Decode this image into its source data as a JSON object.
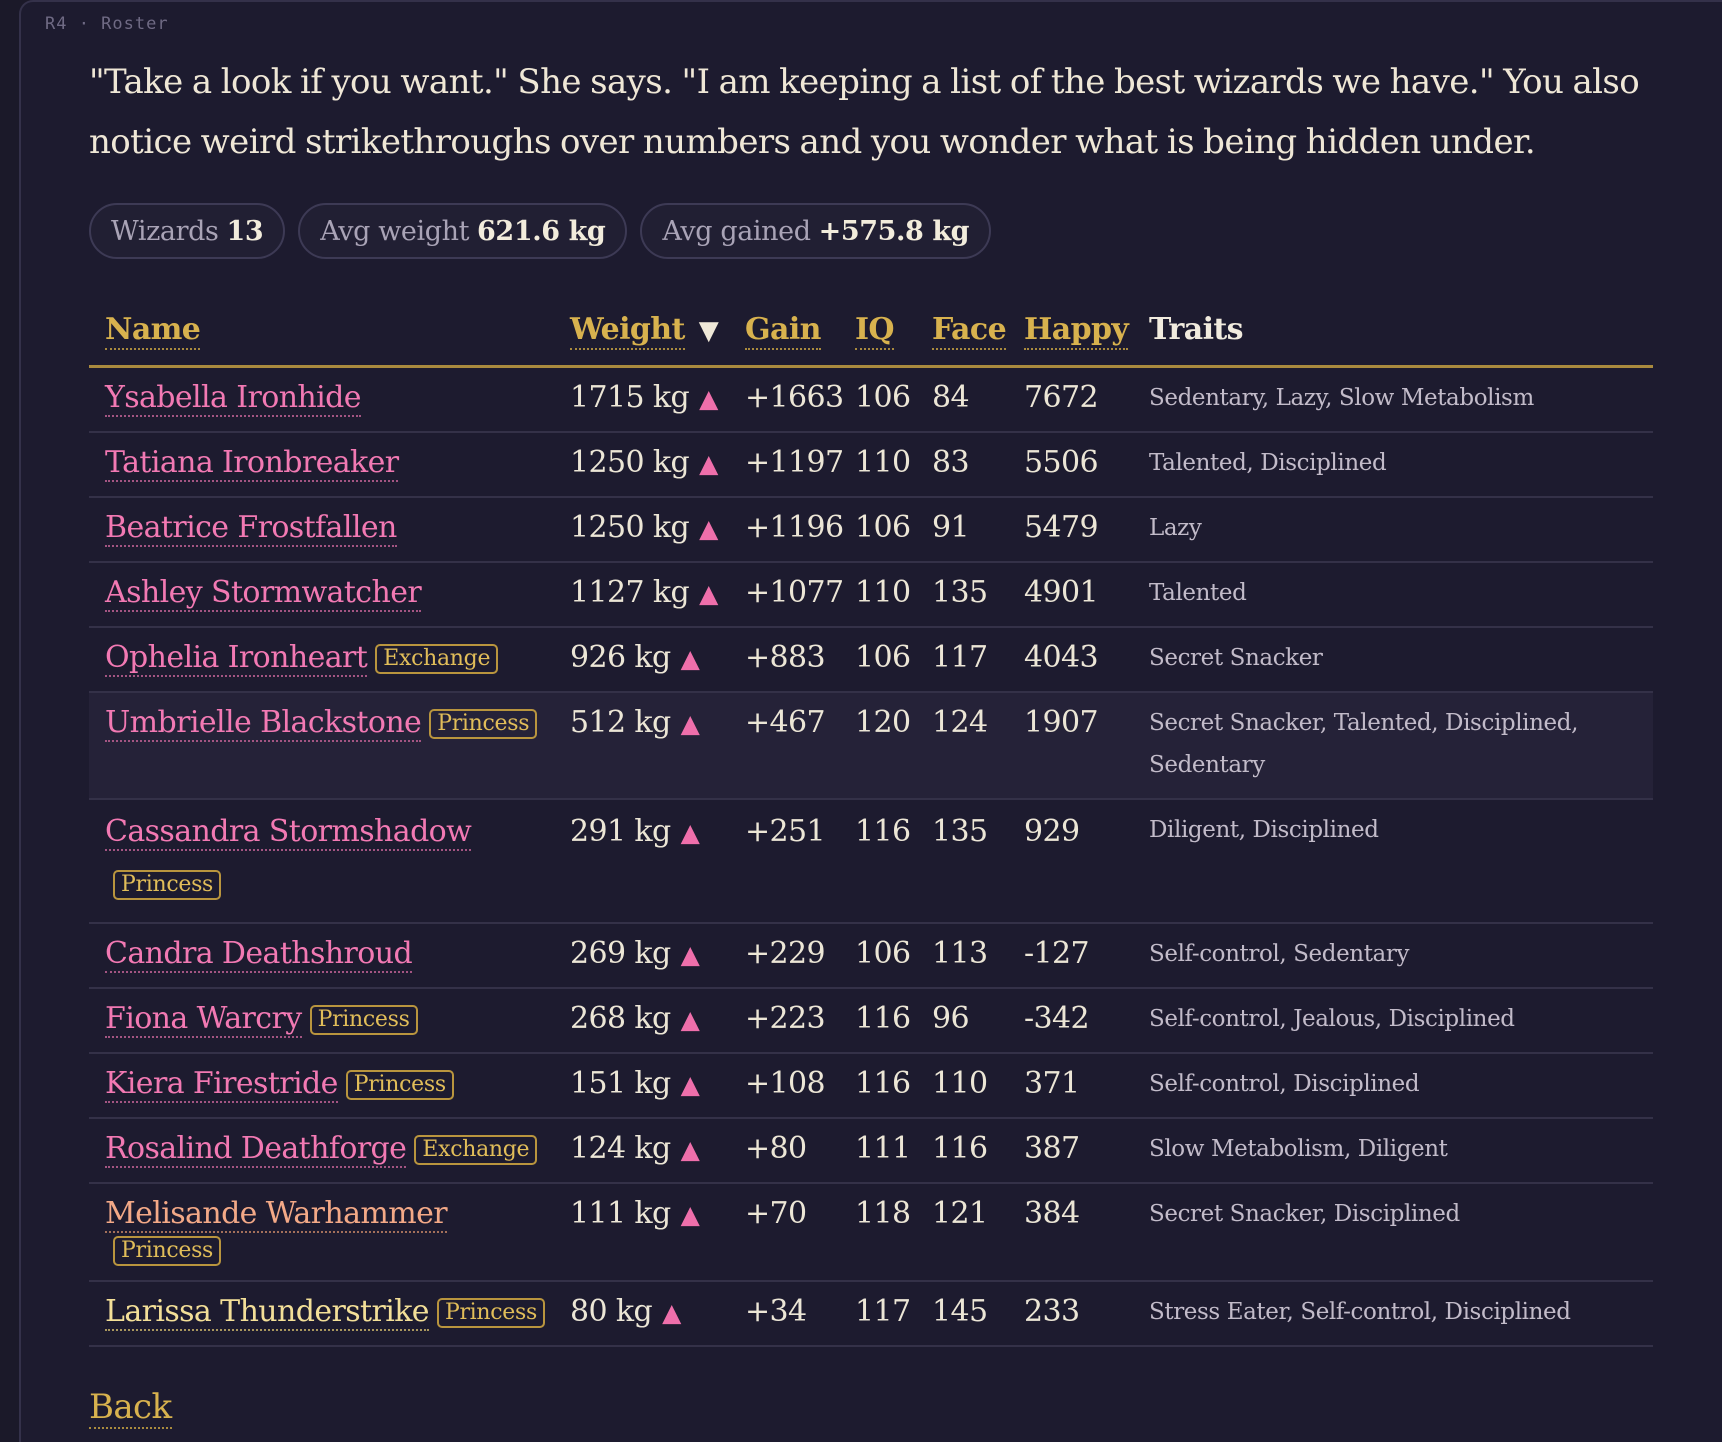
{
  "header": {
    "tag": "R4 · Roster"
  },
  "intro": "\"Take a look if you want.\" She says. \"I am keeping a list of the best wizards we have.\" You also notice weird strikethroughs over numbers and you wonder what is being hidden under.",
  "stats": [
    {
      "label": "Wizards",
      "value": "13"
    },
    {
      "label": "Avg weight",
      "value": "621.6 kg"
    },
    {
      "label": "Avg gained",
      "value": "+575.8 kg"
    }
  ],
  "columns": {
    "name": "Name",
    "weight": "Weight",
    "gain": "Gain",
    "iq": "IQ",
    "face": "Face",
    "happy": "Happy",
    "traits": "Traits"
  },
  "icons": {
    "sort": "triangle-down-icon",
    "trend": "triangle-up-icon"
  },
  "colors": {
    "accent": "#d8b24e",
    "name": "#f279b3",
    "name_orange": "#f3a987",
    "name_yellow": "#f3df98"
  },
  "rows": [
    {
      "name": "Ysabella Ironhide",
      "badge": "",
      "weight": "1715 kg",
      "gain": "+1663",
      "iq": "106",
      "face": "84",
      "happy": "7672",
      "traits": "Sedentary, Lazy, Slow Metabolism"
    },
    {
      "name": "Tatiana Ironbreaker",
      "badge": "",
      "weight": "1250 kg",
      "gain": "+1197",
      "iq": "110",
      "face": "83",
      "happy": "5506",
      "traits": "Talented, Disciplined"
    },
    {
      "name": "Beatrice Frostfallen",
      "badge": "",
      "weight": "1250 kg",
      "gain": "+1196",
      "iq": "106",
      "face": "91",
      "happy": "5479",
      "traits": "Lazy"
    },
    {
      "name": "Ashley Stormwatcher",
      "badge": "",
      "weight": "1127 kg",
      "gain": "+1077",
      "iq": "110",
      "face": "135",
      "happy": "4901",
      "traits": "Talented"
    },
    {
      "name": "Ophelia Ironheart",
      "badge": "Exchange",
      "weight": "926 kg",
      "gain": "+883",
      "iq": "106",
      "face": "117",
      "happy": "4043",
      "traits": "Secret Snacker"
    },
    {
      "name": "Umbrielle Blackstone",
      "badge": "Princess",
      "weight": "512 kg",
      "gain": "+467",
      "iq": "120",
      "face": "124",
      "happy": "1907",
      "traits": "Secret Snacker, Talented, Disciplined, Sedentary"
    },
    {
      "name": "Cassandra Stormshadow",
      "badge": "Princess",
      "weight": "291 kg",
      "gain": "+251",
      "iq": "116",
      "face": "135",
      "happy": "929",
      "traits": "Diligent, Disciplined"
    },
    {
      "name": "Candra Deathshroud",
      "badge": "",
      "weight": "269 kg",
      "gain": "+229",
      "iq": "106",
      "face": "113",
      "happy": "-127",
      "traits": "Self-control, Sedentary"
    },
    {
      "name": "Fiona Warcry",
      "badge": "Princess",
      "weight": "268 kg",
      "gain": "+223",
      "iq": "116",
      "face": "96",
      "happy": "-342",
      "traits": "Self-control, Jealous, Disciplined"
    },
    {
      "name": "Kiera Firestride",
      "badge": "Princess",
      "weight": "151 kg",
      "gain": "+108",
      "iq": "116",
      "face": "110",
      "happy": "371",
      "traits": "Self-control, Disciplined"
    },
    {
      "name": "Rosalind Deathforge",
      "badge": "Exchange",
      "weight": "124 kg",
      "gain": "+80",
      "iq": "111",
      "face": "116",
      "happy": "387",
      "traits": "Slow Metabolism, Diligent"
    },
    {
      "name": "Melisande Warhammer",
      "badge": "Princess",
      "weight": "111 kg",
      "gain": "+70",
      "iq": "118",
      "face": "121",
      "happy": "384",
      "traits": "Secret Snacker, Disciplined"
    },
    {
      "name": "Larissa Thunderstrike",
      "badge": "Princess",
      "weight": "80 kg",
      "gain": "+34",
      "iq": "117",
      "face": "145",
      "happy": "233",
      "traits": "Stress Eater, Self-control, Disciplined"
    }
  ],
  "back_label": "Back"
}
